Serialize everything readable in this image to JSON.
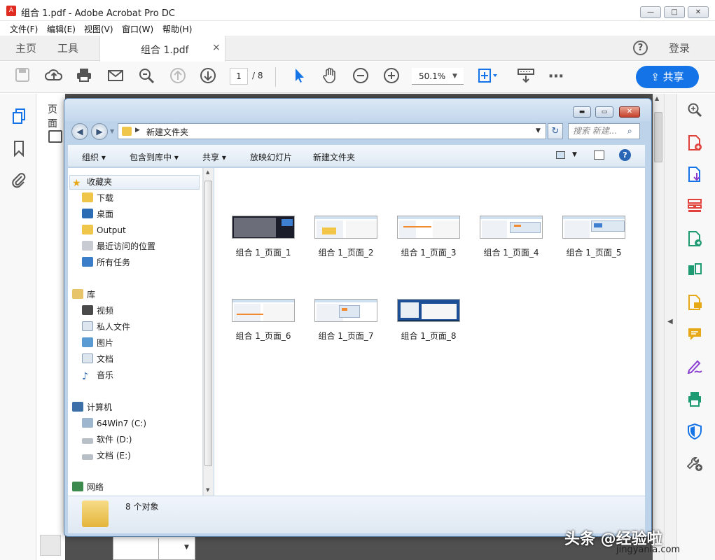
{
  "app": {
    "title": "组合 1.pdf - Adobe Acrobat Pro DC",
    "window_buttons": [
      "—",
      "□",
      "✕"
    ]
  },
  "menubar": [
    "文件(F)",
    "编辑(E)",
    "视图(V)",
    "窗口(W)",
    "帮助(H)"
  ],
  "tabs": {
    "home": "主页",
    "tools": "工具",
    "doc": "组合 1.pdf",
    "doc_close": "×",
    "help": "?",
    "login": "登录"
  },
  "toolbar": {
    "page_current": "1",
    "page_total": "/ 8",
    "zoom": "50.1%",
    "share": "共享"
  },
  "sidepanel": {
    "title": "页面"
  },
  "explorer": {
    "path": "新建文件夹",
    "search_placeholder": "搜索 新建...",
    "commands": [
      "组织",
      "包含到库中",
      "共享",
      "放映幻灯片",
      "新建文件夹"
    ],
    "nav": {
      "favorites": "收藏夹",
      "favorites_items": [
        "下载",
        "桌面",
        "Output",
        "最近访问的位置",
        "所有任务"
      ],
      "libraries": "库",
      "library_items": [
        "视频",
        "私人文件",
        "图片",
        "文档",
        "音乐"
      ],
      "computer": "计算机",
      "drives": [
        "64Win7 (C:)",
        "软件 (D:)",
        "文档 (E:)"
      ],
      "network": "网络"
    },
    "files": [
      "组合 1_页面_1",
      "组合 1_页面_2",
      "组合 1_页面_3",
      "组合 1_页面_4",
      "组合 1_页面_5",
      "组合 1_页面_6",
      "组合 1_页面_7",
      "组合 1_页面_8"
    ],
    "status": "8 个对象"
  },
  "watermark": {
    "main": "头条 @经验啦",
    "url": "jingyanla.com"
  }
}
